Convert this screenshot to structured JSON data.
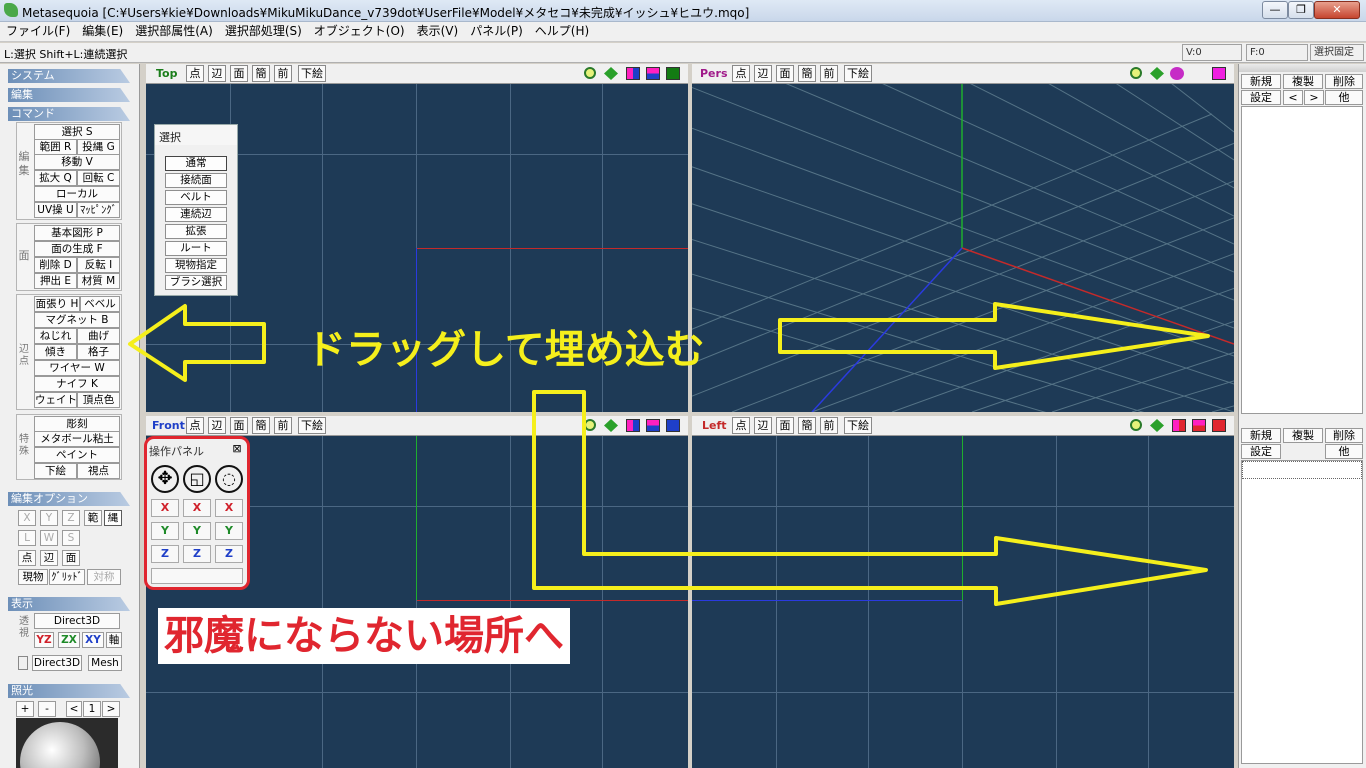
{
  "window": {
    "title": "Metasequoia [C:¥Users¥kie¥Downloads¥MikuMikuDance_v739dot¥UserFile¥Model¥メタセコ¥未完成¥イッシュ¥ヒユウ.mqo]",
    "min": "—",
    "max": "❐",
    "close": "✕"
  },
  "menu": [
    "ファイル(F)",
    "編集(E)",
    "選択部属性(A)",
    "選択部処理(S)",
    "オブジェクト(O)",
    "表示(V)",
    "パネル(P)",
    "ヘルプ(H)"
  ],
  "status": {
    "hint": "L:選択  Shift+L:連続選択",
    "vertex": "V:0",
    "face": "F:0",
    "lock": "選択固定"
  },
  "left": {
    "system": "システム",
    "edit": "編集",
    "command": "コマンド",
    "grp_edit_label": "編集",
    "cmd_select": "選択 S",
    "cmd_range": "範囲 R",
    "cmd_lasso": "投縄 G",
    "cmd_move": "移動 V",
    "cmd_scale": "拡大 Q",
    "cmd_rotate": "回転 C",
    "cmd_local": "ローカル",
    "cmd_uv": "UV操 U",
    "cmd_mapping": "ﾏｯﾋﾟﾝｸﾞ",
    "grp_face_label": "面",
    "cmd_primitive": "基本図形 P",
    "cmd_makeface": "面の生成 F",
    "cmd_delete": "削除 D",
    "cmd_flip": "反転 I",
    "cmd_extrude": "押出 E",
    "cmd_material": "材質 M",
    "grp_vert_label": "辺点",
    "cmd_stretch": "面張り H",
    "cmd_bevel": "ベベル",
    "cmd_magnet": "マグネット B",
    "cmd_twist": "ねじれ",
    "cmd_bend": "曲げ",
    "cmd_tilt": "傾き",
    "cmd_lattice": "格子",
    "cmd_wire": "ワイヤー W",
    "cmd_knife": "ナイフ K",
    "cmd_weight": "ウェイト",
    "cmd_vcolor": "頂点色",
    "grp_special_label": "特殊",
    "cmd_sculpt": "彫刻",
    "cmd_metaball": "メタボール粘土",
    "cmd_paint": "ペイント",
    "cmd_underlay": "下絵",
    "cmd_viewpoint": "視点",
    "edit_options": "編集オプション",
    "opt_x": "X",
    "opt_y": "Y",
    "opt_z": "Z",
    "opt_range": "範",
    "opt_lasso": "縄",
    "opt_l": "L",
    "opt_w": "W",
    "opt_s": "S",
    "opt_point": "点",
    "opt_edge": "辺",
    "opt_face": "面",
    "opt_current": "現物",
    "opt_grid": "ｸﾞﾘｯﾄﾞ",
    "opt_sym": "対称",
    "display": "表示",
    "grp_transp_label": "透視",
    "disp_direct3d": "Direct3D",
    "disp_yz": "YZ",
    "disp_zx": "ZX",
    "disp_xy": "XY",
    "disp_axis": "軸",
    "disp_direct3d2": "Direct3D",
    "disp_mesh": "Mesh",
    "lighting": "照光",
    "light_plus": "+",
    "light_minus": "-",
    "light_prev": "<",
    "light_num": "1",
    "light_next": ">"
  },
  "viewports": {
    "btn_point": "点",
    "btn_edge": "辺",
    "btn_face": "面",
    "btn_simple": "簡",
    "btn_front": "前",
    "btn_underlay": "下絵",
    "top": "Top",
    "pers": "Pers",
    "front": "Front",
    "left": "Left"
  },
  "select_panel": {
    "title": "選択",
    "items": [
      "通常",
      "接続面",
      "ベルト",
      "連続辺",
      "拡張",
      "ルート",
      "現物指定",
      "ブラシ選択"
    ]
  },
  "op_panel": {
    "title": "操作パネル",
    "close": "⊠",
    "move_icon": "✥",
    "scale_icon": "◱",
    "rotate_icon": "◌",
    "x": "X",
    "y": "Y",
    "z": "Z"
  },
  "right": {
    "new": "新規",
    "copy": "複製",
    "delete": "削除",
    "settings": "設定",
    "prev": "<",
    "next": ">",
    "other": "他"
  },
  "annotations": {
    "drag_embed": "ドラッグして埋め込む",
    "out_of_way": "邪魔にならない場所へ"
  },
  "colors": {
    "viewport_bg": "#1e3a56",
    "annot_yellow": "#f5ef1c",
    "annot_red": "#e0262f"
  }
}
